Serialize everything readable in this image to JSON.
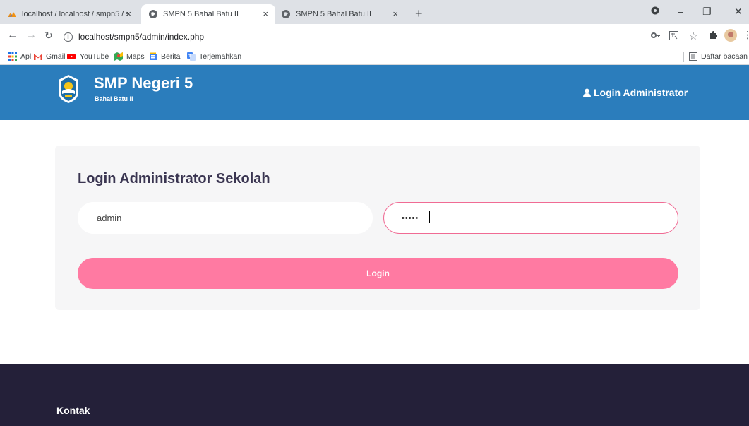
{
  "browser": {
    "tabs": [
      {
        "title": "localhost / localhost / smpn5 / s",
        "close": "×"
      },
      {
        "title": "SMPN 5 Bahal Batu II",
        "close": "×"
      },
      {
        "title": "SMPN 5 Bahal Batu II",
        "close": "×"
      }
    ],
    "new_tab": "+",
    "url": "localhost/smpn5/admin/index.php",
    "bookmarks": [
      {
        "label": "Apl",
        "icon": "apps-grid-icon"
      },
      {
        "label": "Gmail",
        "icon": "gmail-icon"
      },
      {
        "label": "YouTube",
        "icon": "youtube-icon"
      },
      {
        "label": "Maps",
        "icon": "maps-icon"
      },
      {
        "label": "Berita",
        "icon": "news-icon"
      },
      {
        "label": "Terjemahkan",
        "icon": "translate-icon"
      }
    ],
    "reading_list": "Daftar bacaan"
  },
  "header": {
    "school_name": "SMP Negeri 5",
    "school_sub": "Bahal Batu II",
    "nav_login": "Login Administrator",
    "color": "#2b7dbc"
  },
  "login": {
    "title": "Login Administrator Sekolah",
    "username_value": "admin",
    "password_masked": "•••••",
    "button_label": "Login",
    "button_color": "#ff7aa2"
  },
  "footer": {
    "title": "Kontak",
    "color": "#242039"
  }
}
